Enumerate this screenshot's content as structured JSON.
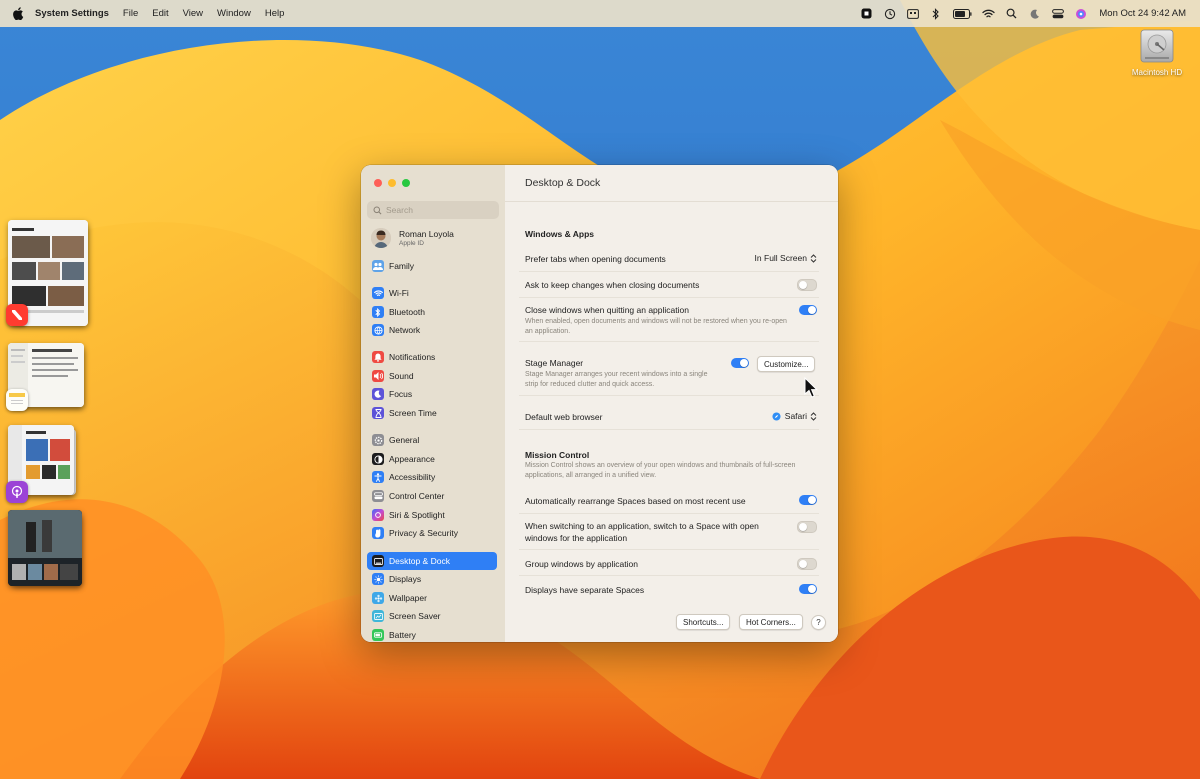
{
  "menubar": {
    "app_name": "System Settings",
    "menus": [
      "File",
      "Edit",
      "View",
      "Window",
      "Help"
    ],
    "clock": "Mon Oct 24  9:42 AM"
  },
  "desktop": {
    "disk_label": "Macintosh HD"
  },
  "window": {
    "search_placeholder": "Search",
    "user": {
      "name": "Roman Loyola",
      "subtitle": "Apple ID"
    },
    "sidebar": [
      {
        "label": "Family",
        "icon": "family-icon",
        "color": "#5fa3e8"
      },
      {
        "label": "Wi-Fi",
        "icon": "wifi-icon",
        "color": "#2f7ff5"
      },
      {
        "label": "Bluetooth",
        "icon": "bluetooth-icon",
        "color": "#2f7ff5"
      },
      {
        "label": "Network",
        "icon": "network-icon",
        "color": "#2f7ff5"
      },
      {
        "label": "Notifications",
        "icon": "notifications-icon",
        "color": "#ef4a42"
      },
      {
        "label": "Sound",
        "icon": "sound-icon",
        "color": "#ef4a42"
      },
      {
        "label": "Focus",
        "icon": "focus-icon",
        "color": "#5d53d8"
      },
      {
        "label": "Screen Time",
        "icon": "screen-time-icon",
        "color": "#5d53d8"
      },
      {
        "label": "General",
        "icon": "general-icon",
        "color": "#8e8e93"
      },
      {
        "label": "Appearance",
        "icon": "appearance-icon",
        "color": "#1c1c1e"
      },
      {
        "label": "Accessibility",
        "icon": "accessibility-icon",
        "color": "#2f7ff5"
      },
      {
        "label": "Control Center",
        "icon": "control-center-icon",
        "color": "#8e8e93"
      },
      {
        "label": "Siri & Spotlight",
        "icon": "siri-icon",
        "color": "#c04cd6"
      },
      {
        "label": "Privacy & Security",
        "icon": "privacy-icon",
        "color": "#2f7ff5"
      },
      {
        "label": "Desktop & Dock",
        "icon": "desktop-dock-icon",
        "color": "#1c1c1e"
      },
      {
        "label": "Displays",
        "icon": "displays-icon",
        "color": "#2f7ff5"
      },
      {
        "label": "Wallpaper",
        "icon": "wallpaper-icon",
        "color": "#3fa8e8"
      },
      {
        "label": "Screen Saver",
        "icon": "screen-saver-icon",
        "color": "#3fb6d9"
      },
      {
        "label": "Battery",
        "icon": "battery-icon",
        "color": "#34c759"
      }
    ],
    "selected_sidebar": "Desktop & Dock",
    "content": {
      "title": "Desktop & Dock",
      "windows_apps": {
        "header": "Windows & Apps",
        "prefer_tabs_label": "Prefer tabs when opening documents",
        "prefer_tabs_value": "In Full Screen",
        "ask_keep_label": "Ask to keep changes when closing documents",
        "ask_keep_on": false,
        "close_windows_label": "Close windows when quitting an application",
        "close_windows_desc": "When enabled, open documents and windows will not be restored when you re-open an application.",
        "close_windows_on": true,
        "stage_manager_label": "Stage Manager",
        "stage_manager_desc": "Stage Manager arranges your recent windows into a single strip for reduced clutter and quick access.",
        "stage_manager_on": true,
        "customize_label": "Customize...",
        "browser_label": "Default web browser",
        "browser_value": "Safari"
      },
      "mission_control": {
        "header": "Mission Control",
        "desc": "Mission Control shows an overview of your open windows and thumbnails of full-screen applications, all arranged in a unified view.",
        "auto_rearrange_label": "Automatically rearrange Spaces based on most recent use",
        "auto_rearrange_on": true,
        "switch_space_label": "When switching to an application, switch to a Space with open windows for the application",
        "switch_space_on": false,
        "group_windows_label": "Group windows by application",
        "group_windows_on": false,
        "separate_spaces_label": "Displays have separate Spaces",
        "separate_spaces_on": true
      },
      "footer": {
        "shortcuts_label": "Shortcuts...",
        "hot_corners_label": "Hot Corners...",
        "help_label": "?"
      }
    }
  }
}
